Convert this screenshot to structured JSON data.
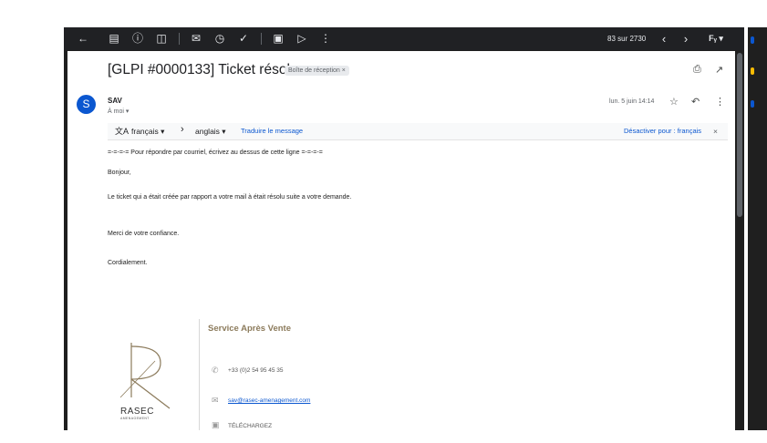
{
  "toolbar": {
    "icons": [
      "back-arrow-icon",
      "archive-icon",
      "report-spam-icon",
      "delete-icon",
      "mark-unread-icon",
      "snooze-icon",
      "add-task-icon",
      "move-to-icon",
      "label-icon",
      "more-vert-icon"
    ],
    "count_text": "83 sur 2730",
    "prev_glyph": "‹",
    "next_glyph": "›",
    "input_tools": "Fᵧ ▾"
  },
  "email": {
    "subject": "[GLPI #0000133] Ticket résolu",
    "label_chip": "Boîte de réception ×",
    "sender_initial": "S",
    "sender_name": "SAV",
    "recipient": "À moi ▾",
    "date": "lun. 5 juin 14:14"
  },
  "translate": {
    "icon": "translate-icon",
    "source_lang": "français ▾",
    "arrow": "›",
    "target_lang": "anglais ▾",
    "translate_link": "Traduire le message",
    "disable_link": "Désactiver pour : français",
    "close": "×"
  },
  "body": {
    "line1": "=-=-=-= Pour répondre par courriel, écrivez au dessus de cette ligne =-=-=-=",
    "line2": "Bonjour,",
    "line3": "Le ticket qui a était créée par rapport a votre mail à était résolu suite a votre demande.",
    "line4": "Merci de votre confiance.",
    "line5": "Cordialement."
  },
  "signature": {
    "title": "Service Après Vente",
    "logo_text": "RASEC",
    "logo_subtext": "AMENAGEMENT",
    "phone": "+33 (0)2 54 95 45 35",
    "email": "sav@rasec-amenagement.com",
    "download": "TÉLÉCHARGEZ"
  },
  "colors": {
    "accent": "#0b57d0",
    "toolbar_bg": "#202124",
    "sig_title": "#8c7b5c"
  }
}
